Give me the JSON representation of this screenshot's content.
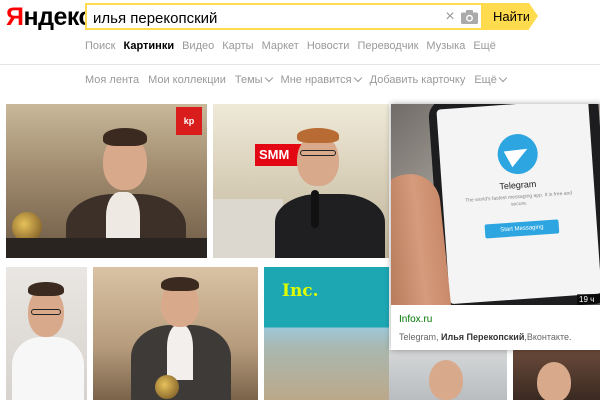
{
  "header": {
    "logo_first": "Я",
    "logo_rest": "ндекс",
    "search_value": "илья перекопский",
    "search_button": "Найти",
    "brand_color": "#ffdb4d"
  },
  "service_nav": [
    {
      "label": "Поиск",
      "active": false
    },
    {
      "label": "Картинки",
      "active": true
    },
    {
      "label": "Видео",
      "active": false
    },
    {
      "label": "Карты",
      "active": false
    },
    {
      "label": "Маркет",
      "active": false
    },
    {
      "label": "Новости",
      "active": false
    },
    {
      "label": "Переводчик",
      "active": false
    },
    {
      "label": "Музыка",
      "active": false
    },
    {
      "label": "Ещё",
      "active": false
    }
  ],
  "sub_nav": [
    {
      "label": "Моя лента",
      "dropdown": false
    },
    {
      "label": "Мои коллекции",
      "dropdown": false
    },
    {
      "label": "Темы",
      "dropdown": true
    },
    {
      "label": "Мне нравится",
      "dropdown": true
    },
    {
      "label": "Добавить карточку",
      "dropdown": false
    },
    {
      "label": "Ещё",
      "dropdown": true
    }
  ],
  "images": {
    "kp_logo": "kp",
    "smm_sign": "SMM",
    "inc_logo": "Inc."
  },
  "popup": {
    "badge": "19 ч",
    "domain": "Infox.ru",
    "desc_prefix": "Telegram, ",
    "desc_bold": "Илья Перекопский",
    "desc_suffix": ",Вконтакте.",
    "app_title": "Telegram",
    "app_subtitle": "The world's fastest messaging app. It is free and secure.",
    "app_button": "Start Messaging",
    "icons": [
      "telegram-icon"
    ]
  }
}
